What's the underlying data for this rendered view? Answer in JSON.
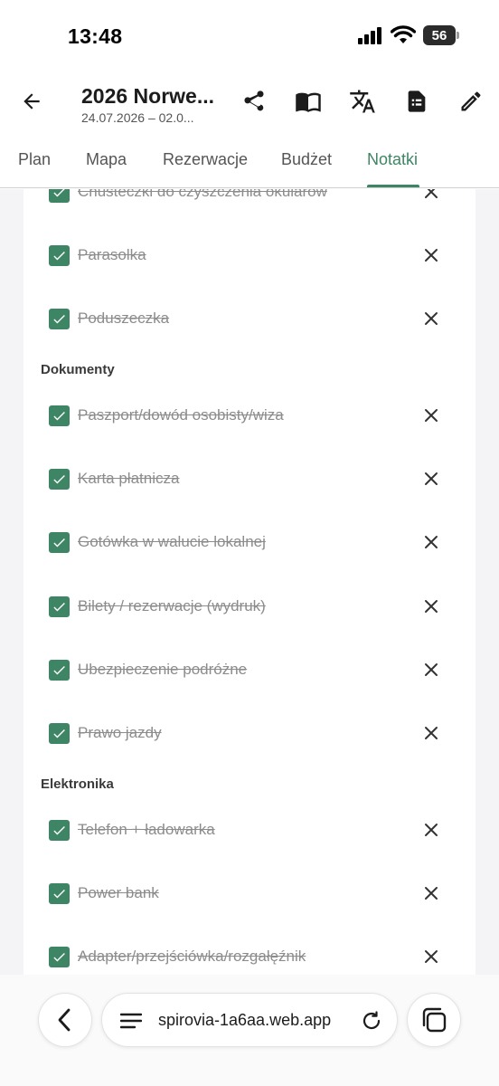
{
  "status_bar": {
    "time": "13:48",
    "battery": "56"
  },
  "header": {
    "title": "2026 Norwe...",
    "dates": "24.07.2026 – 02.0..."
  },
  "tabs": [
    {
      "label": "Plan"
    },
    {
      "label": "Mapa"
    },
    {
      "label": "Rezerwacje"
    },
    {
      "label": "Budżet"
    },
    {
      "label": "Notatki"
    }
  ],
  "active_tab": "Notatki",
  "checklist": {
    "top_items": [
      {
        "label": "Chusteczki do czyszczenia okularów",
        "checked": true
      },
      {
        "label": "Parasolka",
        "checked": true
      },
      {
        "label": "Poduszeczka",
        "checked": true
      }
    ],
    "sections": [
      {
        "title": "Dokumenty",
        "items": [
          {
            "label": "Paszport/dowód osobisty/wiza",
            "checked": true
          },
          {
            "label": "Karta płatnicza",
            "checked": true
          },
          {
            "label": "Gotówka w walucie lokalnej",
            "checked": true
          },
          {
            "label": "Bilety / rezerwacje (wydruk)",
            "checked": true
          },
          {
            "label": "Ubezpieczenie podróżne",
            "checked": true
          },
          {
            "label": "Prawo jazdy",
            "checked": true
          }
        ]
      },
      {
        "title": "Elektronika",
        "items": [
          {
            "label": "Telefon + ładowarka",
            "checked": true
          },
          {
            "label": "Power bank",
            "checked": true
          },
          {
            "label": "Adapter/przejściówka/rozgałęźnik",
            "checked": true
          }
        ]
      }
    ]
  },
  "browser": {
    "url": "spirovia-1a6aa.web.app"
  },
  "icons": {
    "back": "arrow-left-icon",
    "share": "share-icon",
    "guide": "open-book-icon",
    "translate": "translate-icon",
    "document": "document-icon",
    "edit": "pencil-icon",
    "remove": "close-icon",
    "check": "check-icon"
  },
  "colors": {
    "accent": "#3e8565",
    "strikethrough_text": "#8c8c8c",
    "background": "#f4f4f6"
  }
}
